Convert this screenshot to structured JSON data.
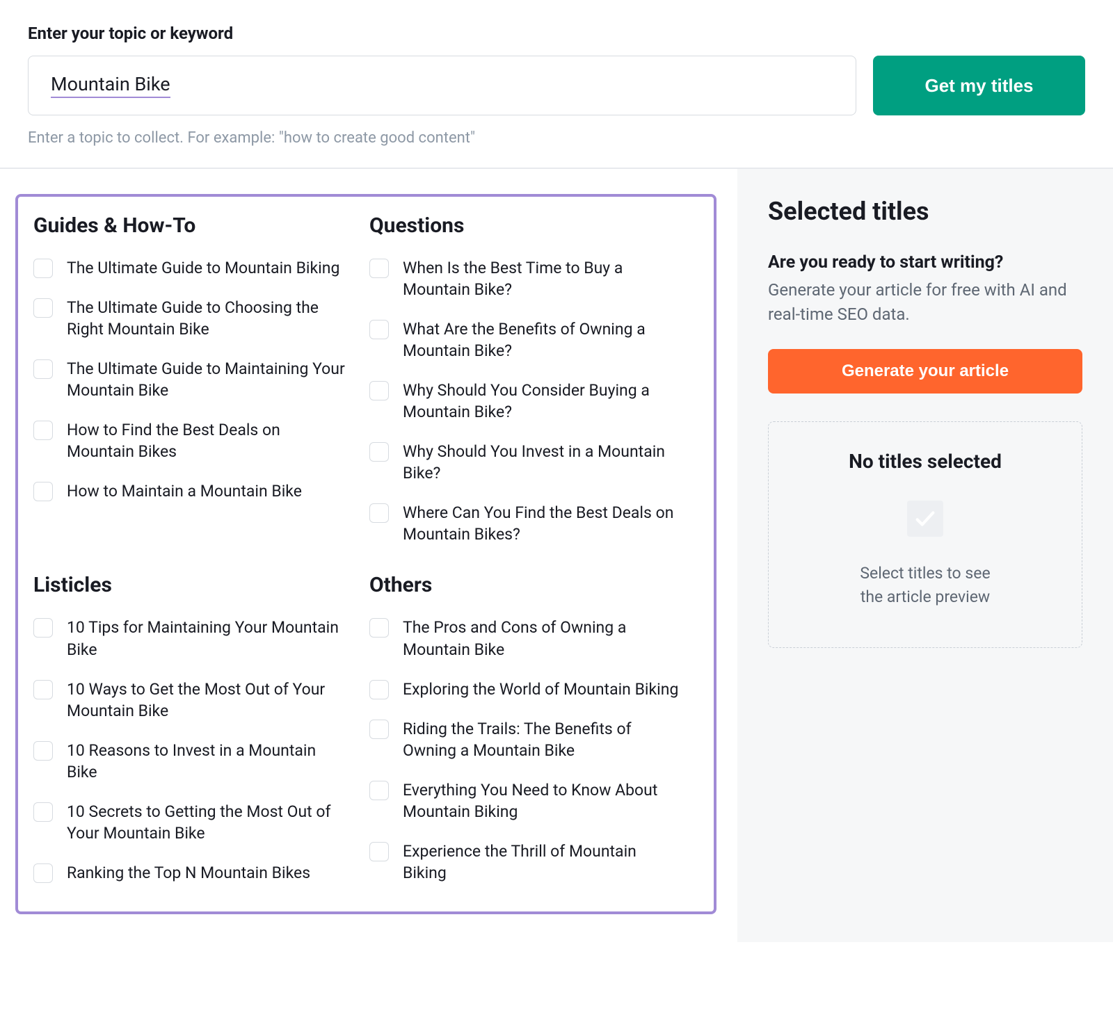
{
  "topic": {
    "label": "Enter your topic or keyword",
    "value": "Mountain Bike",
    "hint_prefix": "Enter a topic to collect. For example: ",
    "hint_example": "\"how to create good content\"",
    "button_label": "Get my titles"
  },
  "categories": [
    {
      "name": "Guides & How-To",
      "items": [
        "The Ultimate Guide to Mountain Biking",
        "The Ultimate Guide to Choosing the Right Mountain Bike",
        "The Ultimate Guide to Maintaining Your Mountain Bike",
        "How to Find the Best Deals on Mountain Bikes",
        "How to Maintain a Mountain Bike"
      ]
    },
    {
      "name": "Questions",
      "items": [
        "When Is the Best Time to Buy a Mountain Bike?",
        "What Are the Benefits of Owning a Mountain Bike?",
        "Why Should You Consider Buying a Mountain Bike?",
        "Why Should You Invest in a Mountain Bike?",
        "Where Can You Find the Best Deals on Mountain Bikes?"
      ]
    },
    {
      "name": "Listicles",
      "items": [
        "10 Tips for Maintaining Your Mountain Bike",
        "10 Ways to Get the Most Out of Your Mountain Bike",
        "10 Reasons to Invest in a Mountain Bike",
        "10 Secrets to Getting the Most Out of Your Mountain Bike",
        "Ranking the Top N Mountain Bikes"
      ]
    },
    {
      "name": "Others",
      "items": [
        "The Pros and Cons of Owning a Mountain Bike",
        "Exploring the World of Mountain Biking",
        "Riding the Trails: The Benefits of Owning a Mountain Bike",
        "Everything You Need to Know About Mountain Biking",
        "Experience the Thrill of Mountain Biking"
      ]
    }
  ],
  "sidebar": {
    "heading": "Selected titles",
    "ready_heading": "Are you ready to start writing?",
    "ready_desc": "Generate your article for free with AI and real-time SEO data.",
    "generate_label": "Generate your article",
    "empty_heading": "No titles selected",
    "empty_desc_line1": "Select titles to see",
    "empty_desc_line2": "the article preview"
  }
}
